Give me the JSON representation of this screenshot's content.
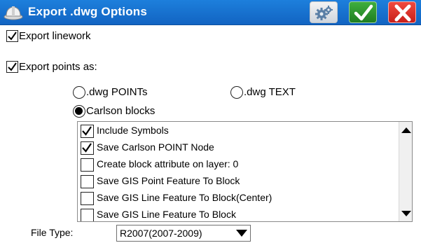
{
  "window": {
    "title": "Export .dwg Options",
    "icons": {
      "app": "hardhat-icon",
      "settings": "gears-icon",
      "ok": "checkmark-icon",
      "cancel": "close-x-icon"
    },
    "colors": {
      "titlebar": "#1670d0",
      "ok": "#2a8f2a",
      "cancel": "#d9302a"
    }
  },
  "options": {
    "export_linework": {
      "label": "Export linework",
      "checked": true
    },
    "export_points": {
      "label": "Export points as:",
      "checked": true
    }
  },
  "point_format": {
    "dwg_points": {
      "label": ".dwg POINTs",
      "selected": false
    },
    "dwg_text": {
      "label": ".dwg TEXT",
      "selected": false
    },
    "carlson_blocks": {
      "label": "Carlson blocks",
      "selected": true
    }
  },
  "block_options": [
    {
      "label": "Include Symbols",
      "checked": true
    },
    {
      "label": "Save Carlson POINT Node",
      "checked": true
    },
    {
      "label": "Create block attribute on layer: 0",
      "checked": false
    },
    {
      "label": "Save GIS Point Feature To Block",
      "checked": false
    },
    {
      "label": "Save GIS Line Feature To Block(Center)",
      "checked": false
    },
    {
      "label": "Save GIS Line Feature To Block",
      "checked": false
    }
  ],
  "file_type": {
    "label": "File Type:",
    "value": "R2007(2007-2009)"
  }
}
